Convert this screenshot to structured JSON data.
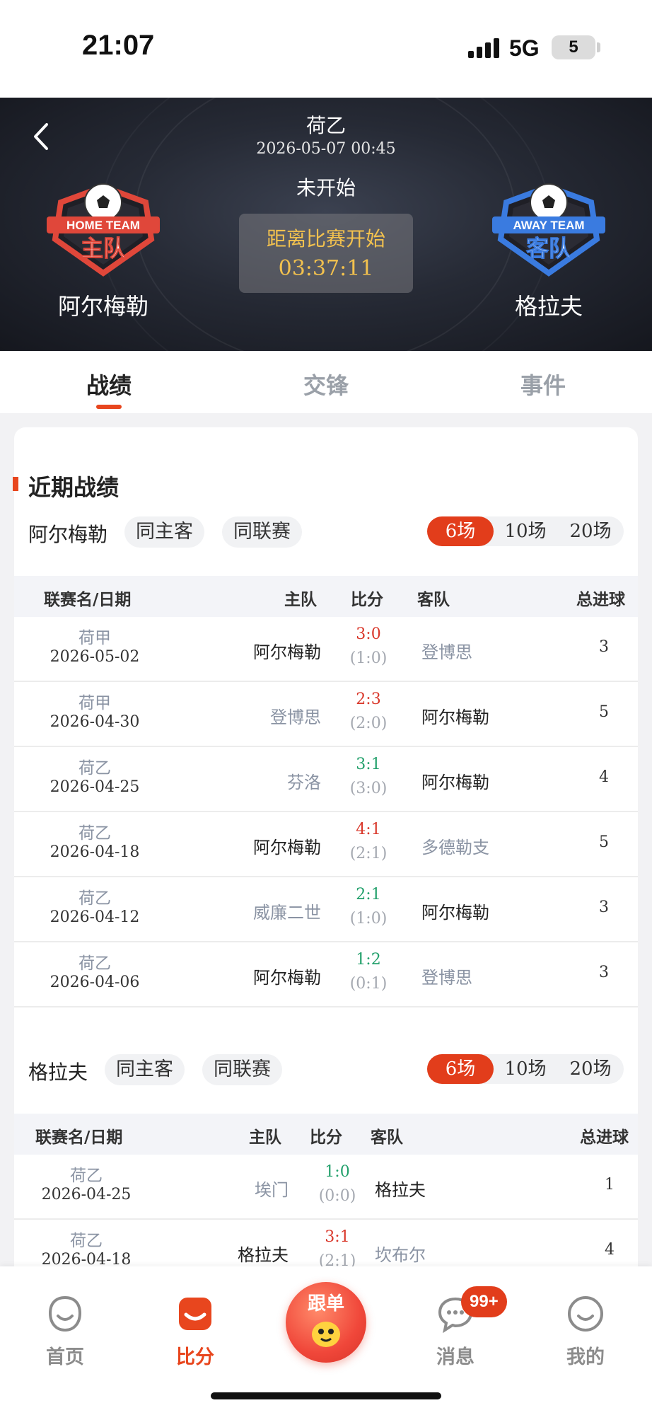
{
  "status_bar": {
    "time": "21:07",
    "network": "5G",
    "battery": "5"
  },
  "header": {
    "league": "荷乙",
    "datetime": "2026-05-07 00:45",
    "status": "未开始",
    "countdown_label": "距离比赛开始",
    "countdown_time": "03:37:11",
    "home_team": {
      "name": "阿尔梅勒",
      "logo_top": "HOME TEAM",
      "logo_main": "主队"
    },
    "away_team": {
      "name": "格拉夫",
      "logo_top": "AWAY TEAM",
      "logo_main": "客队"
    }
  },
  "tabs": [
    {
      "label": "战绩",
      "active": true
    },
    {
      "label": "交锋",
      "active": false
    },
    {
      "label": "事件",
      "active": false
    }
  ],
  "section": {
    "title": "近期战绩"
  },
  "columns": {
    "league_date": "联赛名/日期",
    "home": "主队",
    "score": "比分",
    "away": "客队",
    "total": "总进球"
  },
  "home_recent": {
    "team": "阿尔梅勒",
    "chips": [
      "同主客",
      "同联赛"
    ],
    "counts": [
      "6场",
      "10场",
      "20场"
    ],
    "active_count": "6场",
    "rows": [
      {
        "league": "荷甲",
        "date": "2026-05-02",
        "home": "阿尔梅勒",
        "score": "3:0",
        "ht": "(1:0)",
        "away": "登博思",
        "total": "3",
        "result": "win",
        "home_is_team": true
      },
      {
        "league": "荷甲",
        "date": "2026-04-30",
        "home": "登博思",
        "score": "2:3",
        "ht": "(2:0)",
        "away": "阿尔梅勒",
        "total": "5",
        "result": "win",
        "home_is_team": false
      },
      {
        "league": "荷乙",
        "date": "2026-04-25",
        "home": "芬洛",
        "score": "3:1",
        "ht": "(3:0)",
        "away": "阿尔梅勒",
        "total": "4",
        "result": "loss",
        "home_is_team": false
      },
      {
        "league": "荷乙",
        "date": "2026-04-18",
        "home": "阿尔梅勒",
        "score": "4:1",
        "ht": "(2:1)",
        "away": "多德勒支",
        "total": "5",
        "result": "win",
        "home_is_team": true
      },
      {
        "league": "荷乙",
        "date": "2026-04-12",
        "home": "威廉二世",
        "score": "2:1",
        "ht": "(1:0)",
        "away": "阿尔梅勒",
        "total": "3",
        "result": "loss",
        "home_is_team": false
      },
      {
        "league": "荷乙",
        "date": "2026-04-06",
        "home": "阿尔梅勒",
        "score": "1:2",
        "ht": "(0:1)",
        "away": "登博思",
        "total": "3",
        "result": "loss",
        "home_is_team": true
      }
    ]
  },
  "away_recent": {
    "team": "格拉夫",
    "chips": [
      "同主客",
      "同联赛"
    ],
    "counts": [
      "6场",
      "10场",
      "20场"
    ],
    "active_count": "6场",
    "rows": [
      {
        "league": "荷乙",
        "date": "2026-04-25",
        "home": "埃门",
        "score": "1:0",
        "ht": "(0:0)",
        "away": "格拉夫",
        "total": "1",
        "result": "loss",
        "home_is_team": false
      },
      {
        "league": "荷乙",
        "date": "2026-04-18",
        "home": "格拉夫",
        "score": "3:1",
        "ht": "(2:1)",
        "away": "坎布尔",
        "total": "4",
        "result": "win",
        "home_is_team": true
      }
    ]
  },
  "bottom_nav": [
    {
      "label": "首页",
      "icon": "home-face-icon",
      "active": false
    },
    {
      "label": "比分",
      "icon": "score-tag-icon",
      "active": true
    },
    {
      "label": "跟单",
      "icon": "follow-mascot-icon",
      "active": false
    },
    {
      "label": "消息",
      "icon": "chat-bubble-icon",
      "active": false,
      "badge": "99+"
    },
    {
      "label": "我的",
      "icon": "profile-face-icon",
      "active": false
    }
  ],
  "colors": {
    "accent": "#e8461e",
    "win": "#d9372a",
    "loss": "#22a06b",
    "gold": "#f2c14e"
  }
}
